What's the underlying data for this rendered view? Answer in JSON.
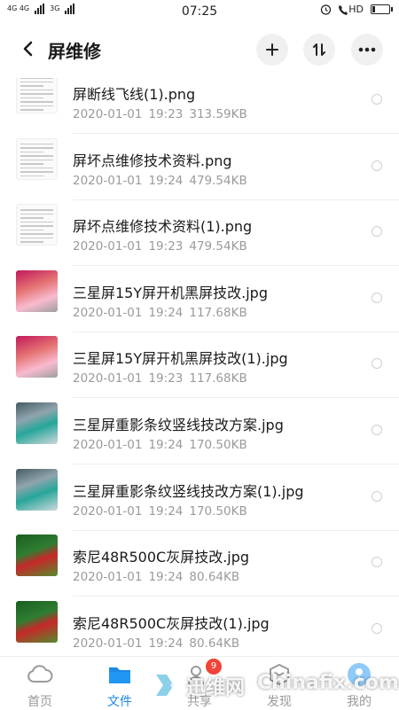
{
  "status_bar": {
    "network": "4G 4G",
    "signal": "3G",
    "time": "07:25",
    "hd": "HD",
    "battery_level": 0.2
  },
  "header": {
    "title": "屏维修",
    "add_icon": "plus-icon",
    "sort_icon": "sort-icon",
    "more_icon": "more-icon"
  },
  "files": [
    {
      "name": "屏断线飞线(1).png",
      "date": "2020-01-01",
      "time": "19:23",
      "size": "313.59KB",
      "thumb": "document"
    },
    {
      "name": "屏坏点维修技术资料.png",
      "date": "2020-01-01",
      "time": "19:24",
      "size": "479.54KB",
      "thumb": "document"
    },
    {
      "name": "屏坏点维修技术资料(1).png",
      "date": "2020-01-01",
      "time": "19:23",
      "size": "479.54KB",
      "thumb": "document"
    },
    {
      "name": "三星屏15Y屏开机黑屏技改.jpg",
      "date": "2020-01-01",
      "time": "19:24",
      "size": "117.68KB",
      "thumb": "pink"
    },
    {
      "name": "三星屏15Y屏开机黑屏技改(1).jpg",
      "date": "2020-01-01",
      "time": "19:23",
      "size": "117.68KB",
      "thumb": "pink"
    },
    {
      "name": "三星屏重影条纹竖线技改方案.jpg",
      "date": "2020-01-01",
      "time": "19:24",
      "size": "170.50KB",
      "thumb": "blue"
    },
    {
      "name": "三星屏重影条纹竖线技改方案(1).jpg",
      "date": "2020-01-01",
      "time": "19:24",
      "size": "170.50KB",
      "thumb": "blue"
    },
    {
      "name": "索尼48R500C灰屏技改.jpg",
      "date": "2020-01-01",
      "time": "19:24",
      "size": "80.64KB",
      "thumb": "green"
    },
    {
      "name": "索尼48R500C灰屏技改(1).jpg",
      "date": "2020-01-01",
      "time": "19:24",
      "size": "80.64KB",
      "thumb": "green"
    }
  ],
  "nav": {
    "tabs": [
      {
        "label": "首页",
        "icon": "cloud-icon"
      },
      {
        "label": "文件",
        "icon": "folder-icon",
        "active": true
      },
      {
        "label": "共享",
        "icon": "share-icon",
        "badge": "9"
      },
      {
        "label": "发现",
        "icon": "discover-icon"
      },
      {
        "label": "我的",
        "icon": "user-icon"
      }
    ]
  },
  "watermark": {
    "text_cn": "迅维网",
    "text_en": "Chinafix.com"
  },
  "colors": {
    "accent": "#1e88e5",
    "badge": "#f04438",
    "meta_text": "#9a9a9a"
  }
}
